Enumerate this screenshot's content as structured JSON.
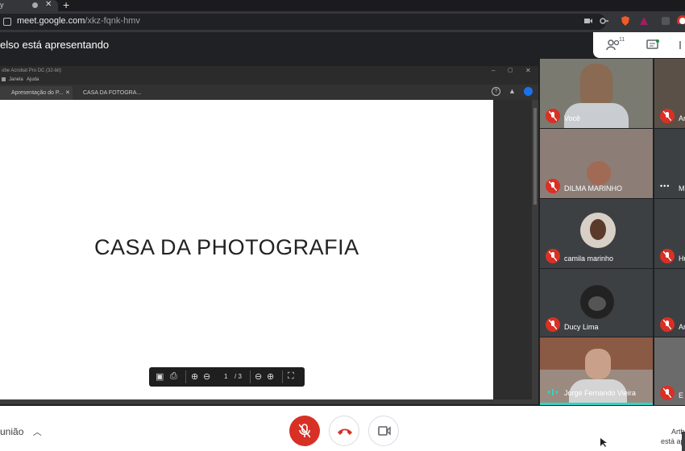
{
  "browser": {
    "tab_title": "y",
    "url_host": "meet.google.com",
    "url_path": "/xkz-fqnk-hmv",
    "new_tab_label": "+"
  },
  "meet": {
    "presenting_text": "elso está apresentando",
    "people_count": "11"
  },
  "acrobat": {
    "window_title": "obe Acrobat Pro DC (32-bit)",
    "menu": [
      "Janela",
      "Ajuda"
    ],
    "tabs": [
      {
        "label": "Apresentação do P..."
      },
      {
        "label": "CASA DA FOTOGRA..."
      }
    ],
    "slide_title": "CASA DA PHOTOGRAFIA",
    "page_current": "1",
    "page_total": "/ 3"
  },
  "participants": [
    {
      "name": "Você",
      "muted": true
    },
    {
      "name": "Ar",
      "muted": true
    },
    {
      "name": "DILMA MARINHO",
      "muted": true
    },
    {
      "name": "Mi",
      "muted": false
    },
    {
      "name": "camila marinho",
      "muted": true
    },
    {
      "name": "Hu",
      "muted": true
    },
    {
      "name": "Ducy Lima",
      "muted": true
    },
    {
      "name": "Ar",
      "muted": true
    },
    {
      "name": "Jorge Fernando Vieira",
      "muted": false
    },
    {
      "name": "E",
      "muted": true
    }
  ],
  "bottom": {
    "meeting_details": "união",
    "presenter_note_line1": "Arth",
    "presenter_note_line2": "está ap"
  },
  "colors": {
    "mute_red": "#d93025",
    "meet_dark": "#202124",
    "active_speaker": "#1e8e3e"
  }
}
